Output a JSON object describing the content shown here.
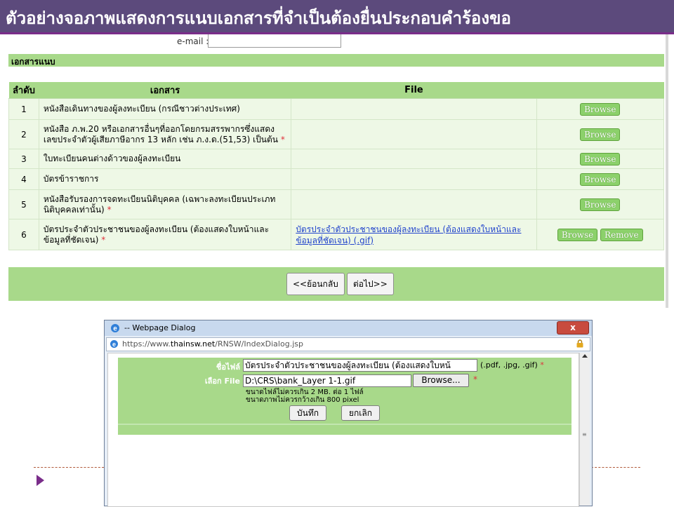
{
  "slide": {
    "title": "ตัวอย่างจอภาพแสดงการแนบเอกสารที่จำเป็นต้องยื่นประกอบคำร้องขอ"
  },
  "form": {
    "email_label": "e-mail :",
    "section_label": "เอกสารแนบ",
    "columns": [
      "ลำดับ",
      "เอกสาร",
      "File"
    ],
    "rows": [
      {
        "num": "1",
        "doc": "หนังสือเดินทางของผู้ลงทะเบียน (กรณีชาวต่างประเทศ)",
        "required": "",
        "file": "",
        "browse": "Browse",
        "remove": ""
      },
      {
        "num": "2",
        "doc": "หนังสือ ภ.พ.20 หรือเอกสารอื่นๆที่ออกโดยกรมสรรพากรซึ่งแสดงเลขประจำตัวผู้เสียภาษีอากร 13 หลัก เช่น ภ.ง.ด.(51,53) เป็นต้น",
        "required": "*",
        "file": "",
        "browse": "Browse",
        "remove": ""
      },
      {
        "num": "3",
        "doc": "ใบทะเบียนคนต่างด้าวของผู้ลงทะเบียน",
        "required": "",
        "file": "",
        "browse": "Browse",
        "remove": ""
      },
      {
        "num": "4",
        "doc": "บัตรข้าราชการ",
        "required": "",
        "file": "",
        "browse": "Browse",
        "remove": ""
      },
      {
        "num": "5",
        "doc": "หนังสือรับรองการจดทะเบียนนิติบุคคล (เฉพาะลงทะเบียนประเภทนิติบุคคลเท่านั้น)",
        "required": "*",
        "file": "",
        "browse": "Browse",
        "remove": ""
      },
      {
        "num": "6",
        "doc": "บัตรประจำตัวประชาชนของผู้ลงทะเบียน (ต้องแสดงใบหน้าและข้อมูลที่ชัดเจน)",
        "required": "*",
        "file": "บัตรประจำตัวประชาชนของผู้ลงทะเบียน (ต้องแสดงใบหน้าและข้อมูลที่ชัดเจน) (.gif)",
        "browse": "Browse",
        "remove": "Remove"
      }
    ],
    "back_button": "<<ย้อนกลับ",
    "next_button": "ต่อไป>>"
  },
  "dialog": {
    "title": "-- Webpage Dialog",
    "url_prefix": "https://www.",
    "url_domain": "thainsw.net",
    "url_path": "/RNSW/IndexDialog.jsp",
    "filename_label": "ชื่อไฟล์",
    "filename_value": "บัตรประจำตัวประชาชนของผู้ลงทะเบียน (ต้องแสดงใบหน้",
    "filename_hint": "(.pdf, .jpg, .gif)",
    "filename_required": "*",
    "choose_file_label": "เลือก File",
    "file_path": "D:\\CRS\\bank_Layer 1-1.gif",
    "browse_button": "Browse...",
    "file_required": "*",
    "note_size": "ขนาดไฟล์ไม่ควรเกิน 2 MB. ต่อ 1 ไฟล์",
    "note_width": "ขนาดภาพไม่ควรกว้างเกิน 800 pixel",
    "save_button": "บันทึก",
    "cancel_button": "ยกเลิก",
    "close_glyph": "x"
  },
  "colors": {
    "title_bar": "#5c4a7c",
    "table_green": "#a8d98a",
    "row_green": "#eef8e6",
    "button_green": "#8cd16b",
    "required_red": "#e0303a",
    "link_blue": "#2244cc"
  }
}
